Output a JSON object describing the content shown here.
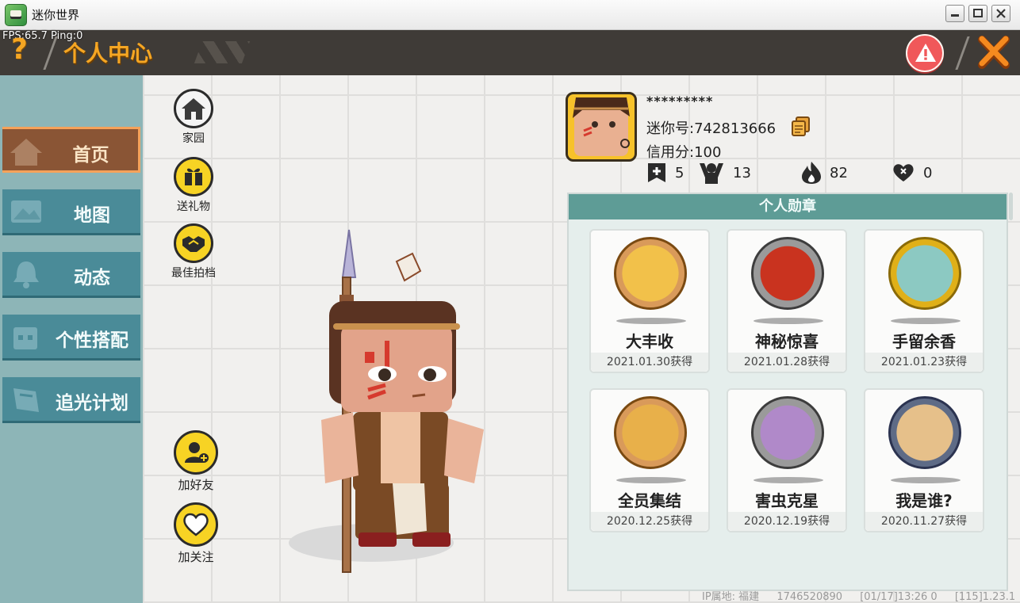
{
  "window": {
    "title": "迷你世界"
  },
  "overlay": {
    "fps": "FPS:65.7",
    "ping": "Ping:0"
  },
  "header": {
    "title": "个人中心",
    "help_label": "?"
  },
  "sidebar": {
    "items": [
      {
        "label": "首页",
        "icon": "home-icon",
        "active": true
      },
      {
        "label": "地图",
        "icon": "map-icon",
        "active": false
      },
      {
        "label": "动态",
        "icon": "bell-icon",
        "active": false
      },
      {
        "label": "个性搭配",
        "icon": "outfit-icon",
        "active": false
      },
      {
        "label": "追光计划",
        "icon": "book-icon",
        "active": false
      }
    ]
  },
  "actions": {
    "home": "家园",
    "gift": "送礼物",
    "best_photo": "最佳拍档",
    "add_friend": "加好友",
    "follow": "加关注"
  },
  "profile": {
    "name": "*********",
    "mini_id": "迷你号:742813666",
    "credit": "信用分:100",
    "stats": [
      {
        "icon": "bookmark-plus-icon",
        "value": "5"
      },
      {
        "icon": "cheer-icon",
        "value": "13"
      },
      {
        "icon": "flame-icon",
        "value": "82"
      },
      {
        "icon": "heart-icon",
        "value": "0"
      }
    ]
  },
  "badges": {
    "title": "个人勋章",
    "items": [
      {
        "name": "大丰收",
        "date": "2021.01.30获得",
        "ring": "#d99a5a",
        "fill": "#f2c14a"
      },
      {
        "name": "神秘惊喜",
        "date": "2021.01.28获得",
        "ring": "#9a9a9a",
        "fill": "#c9331f"
      },
      {
        "name": "手留余香",
        "date": "2021.01.23获得",
        "ring": "#e0b018",
        "fill": "#8cc9c2"
      },
      {
        "name": "全员集结",
        "date": "2020.12.25获得",
        "ring": "#d99a5a",
        "fill": "#e8b04a"
      },
      {
        "name": "害虫克星",
        "date": "2020.12.19获得",
        "ring": "#9a9a9a",
        "fill": "#b089c9"
      },
      {
        "name": "我是谁?",
        "date": "2020.11.27获得",
        "ring": "#5e6b86",
        "fill": "#e6c08a"
      }
    ]
  },
  "footer": {
    "ip": "IP属地: 福建",
    "session": "1746520890",
    "time": "[01/17]13:26 0",
    "version": "[115]1.23.1"
  },
  "colors": {
    "accent": "#f5a623",
    "sidebar_bg": "#8db5b7",
    "nav_item": "#4a8b98",
    "nav_active": "#8a5535",
    "panel_head": "#5e9c96",
    "report": "#f0585a"
  }
}
